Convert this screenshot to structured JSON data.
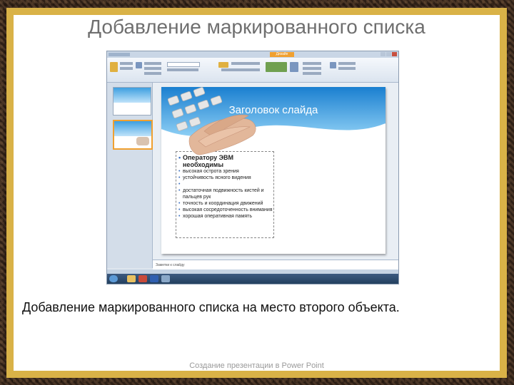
{
  "slide": {
    "title": "Добавление маркированного списка",
    "caption": "Добавление маркированного списка на место второго объекта.",
    "footer": "Создание презентации в Power Point"
  },
  "screenshot": {
    "slide_title_placeholder": "Заголовок слайда",
    "list_heading": "Оператору ЭВМ необходимы",
    "list_items": [
      "высокая острота зрения",
      "устойчивость ясного видения",
      "",
      "достаточная подвижность кистей и пальцев рук",
      "точность и координация движений",
      "высокая сосредоточенность внимания",
      "хорошая оперативная память"
    ],
    "notes_placeholder": "Заметки к слайду",
    "ribbon_active_tab": "Дизайн",
    "colors": {
      "frame": "#d9b247",
      "slide_header": "#2f8fd6",
      "tab_highlight": "#f0a030"
    }
  }
}
